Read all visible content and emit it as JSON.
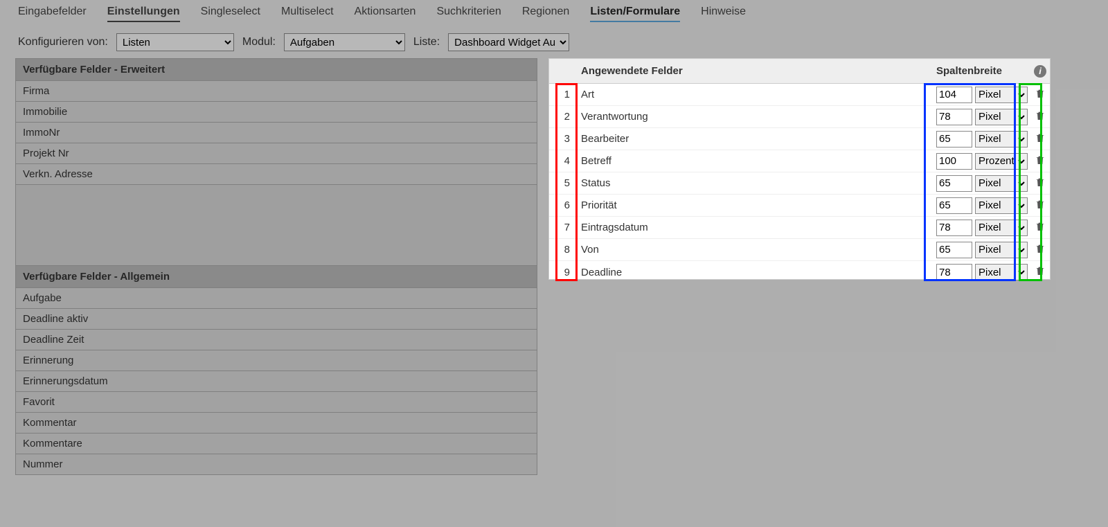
{
  "tabs": {
    "items": [
      {
        "label": "Eingabefelder"
      },
      {
        "label": "Einstellungen"
      },
      {
        "label": "Singleselect"
      },
      {
        "label": "Multiselect"
      },
      {
        "label": "Aktionsarten"
      },
      {
        "label": "Suchkriterien"
      },
      {
        "label": "Regionen"
      },
      {
        "label": "Listen/Formulare"
      },
      {
        "label": "Hinweise"
      }
    ],
    "selected_index": 1,
    "active_index": 7
  },
  "config": {
    "configure_label": "Konfigurieren von:",
    "configure_value": "Listen",
    "module_label": "Modul:",
    "module_value": "Aufgaben",
    "list_label": "Liste:",
    "list_value": "Dashboard Widget Au"
  },
  "left": {
    "panel_ext_title": "Verfügbare Felder - Erweitert",
    "ext_items": [
      "Firma",
      "Immobilie",
      "ImmoNr",
      "Projekt Nr",
      "Verkn. Adresse"
    ],
    "panel_gen_title": "Verfügbare Felder - Allgemein",
    "gen_items": [
      "Aufgabe",
      "Deadline aktiv",
      "Deadline Zeit",
      "Erinnerung",
      "Erinnerungsdatum",
      "Favorit",
      "Kommentar",
      "Kommentare",
      "Nummer"
    ]
  },
  "right": {
    "header_applied": "Angewendete Felder",
    "header_width": "Spaltenbreite",
    "unit_options": [
      "Pixel",
      "Prozent"
    ],
    "rows": [
      {
        "n": "1",
        "name": "Art",
        "w": "104",
        "unit": "Pixel"
      },
      {
        "n": "2",
        "name": "Verantwortung",
        "w": "78",
        "unit": "Pixel"
      },
      {
        "n": "3",
        "name": "Bearbeiter",
        "w": "65",
        "unit": "Pixel"
      },
      {
        "n": "4",
        "name": "Betreff",
        "w": "100",
        "unit": "Prozent"
      },
      {
        "n": "5",
        "name": "Status",
        "w": "65",
        "unit": "Pixel"
      },
      {
        "n": "6",
        "name": "Priorität",
        "w": "65",
        "unit": "Pixel"
      },
      {
        "n": "7",
        "name": "Eintragsdatum",
        "w": "78",
        "unit": "Pixel"
      },
      {
        "n": "8",
        "name": "Von",
        "w": "65",
        "unit": "Pixel"
      },
      {
        "n": "9",
        "name": "Deadline",
        "w": "78",
        "unit": "Pixel"
      }
    ]
  },
  "info_glyph": "i"
}
